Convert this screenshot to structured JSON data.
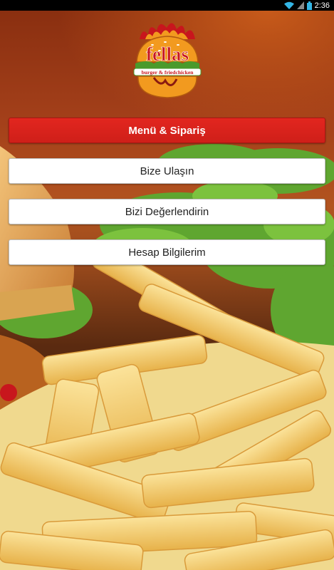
{
  "status_bar": {
    "time": "2:36"
  },
  "brand": {
    "name": "fellas",
    "tagline": "burger & friedchicken"
  },
  "menu": {
    "order": "Menü & Sipariş",
    "contact": "Bize Ulaşın",
    "rate": "Bizi Değerlendirin",
    "account": "Hesap Bilgilerim"
  },
  "colors": {
    "primary_button": "#d8231c",
    "logo_orange": "#f29a1f",
    "logo_red": "#c8161d",
    "logo_green": "#4a9a2c"
  }
}
